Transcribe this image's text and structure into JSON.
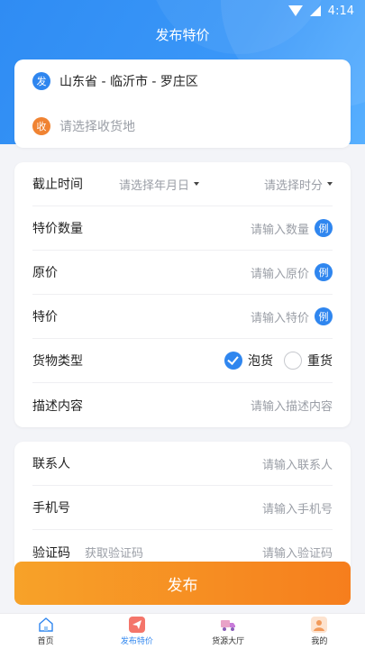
{
  "status_bar": {
    "time": "4:14"
  },
  "header": {
    "title": "发布特价"
  },
  "address": {
    "from_tag": "发",
    "from_value": "山东省 - 临沂市 - 罗庄区",
    "to_tag": "收",
    "to_placeholder": "请选择收货地"
  },
  "form": {
    "deadline": {
      "label": "截止时间",
      "date_placeholder": "请选择年月日",
      "time_placeholder": "请选择时分"
    },
    "quantity": {
      "label": "特价数量",
      "placeholder": "请输入数量",
      "example": "例"
    },
    "original_price": {
      "label": "原价",
      "placeholder": "请输入原价",
      "example": "例"
    },
    "special_price": {
      "label": "特价",
      "placeholder": "请输入特价",
      "example": "例"
    },
    "cargo_type": {
      "label": "货物类型",
      "options": [
        "泡货",
        "重货"
      ],
      "selected": "泡货"
    },
    "description": {
      "label": "描述内容",
      "placeholder": "请输入描述内容"
    }
  },
  "contact": {
    "name": {
      "label": "联系人",
      "placeholder": "请输入联系人"
    },
    "phone": {
      "label": "手机号",
      "placeholder": "请输入手机号"
    },
    "code": {
      "label": "验证码",
      "action": "获取验证码",
      "placeholder": "请输入验证码"
    }
  },
  "publish_label": "发布",
  "tabbar": {
    "items": [
      {
        "label": "首页",
        "icon": "home-icon"
      },
      {
        "label": "发布特价",
        "icon": "send-icon"
      },
      {
        "label": "货源大厅",
        "icon": "truck-icon"
      },
      {
        "label": "我的",
        "icon": "user-icon"
      }
    ],
    "active_index": 1
  },
  "colors": {
    "primary": "#2f86ef",
    "accent": "#f67e1d",
    "muted": "#9a9ea6"
  }
}
